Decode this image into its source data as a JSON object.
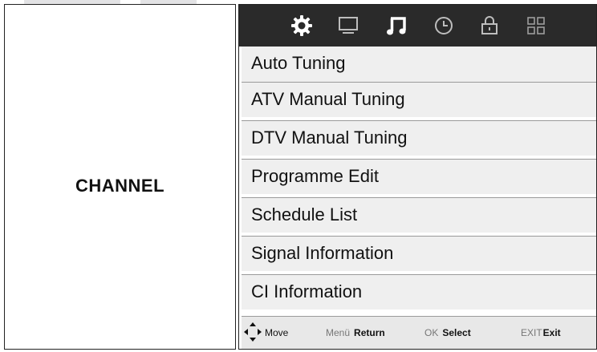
{
  "left_panel": {
    "title": "CHANNEL"
  },
  "icon_bar": {
    "background": "#2a2a2a",
    "icons": [
      {
        "name": "settings-gear-icon",
        "active": true
      },
      {
        "name": "monitor-icon",
        "active": false
      },
      {
        "name": "music-note-icon",
        "active": true
      },
      {
        "name": "clock-icon",
        "active": false
      },
      {
        "name": "lock-icon",
        "active": false
      },
      {
        "name": "grid-icon",
        "active": false
      }
    ]
  },
  "menu": {
    "items": [
      {
        "label": "Auto Tuning"
      },
      {
        "label": "ATV Manual Tuning"
      },
      {
        "label": "DTV Manual Tuning"
      },
      {
        "label": "Programme Edit"
      },
      {
        "label": "Schedule List"
      },
      {
        "label": "Signal Information"
      },
      {
        "label": "CI Information"
      }
    ]
  },
  "hints": {
    "move": {
      "key": "",
      "action": "Move"
    },
    "menu": {
      "key": "Menü",
      "action": "Return"
    },
    "ok": {
      "key": "OK",
      "action": "Select"
    },
    "exit": {
      "key": "EXIT",
      "action": "Exit"
    }
  }
}
